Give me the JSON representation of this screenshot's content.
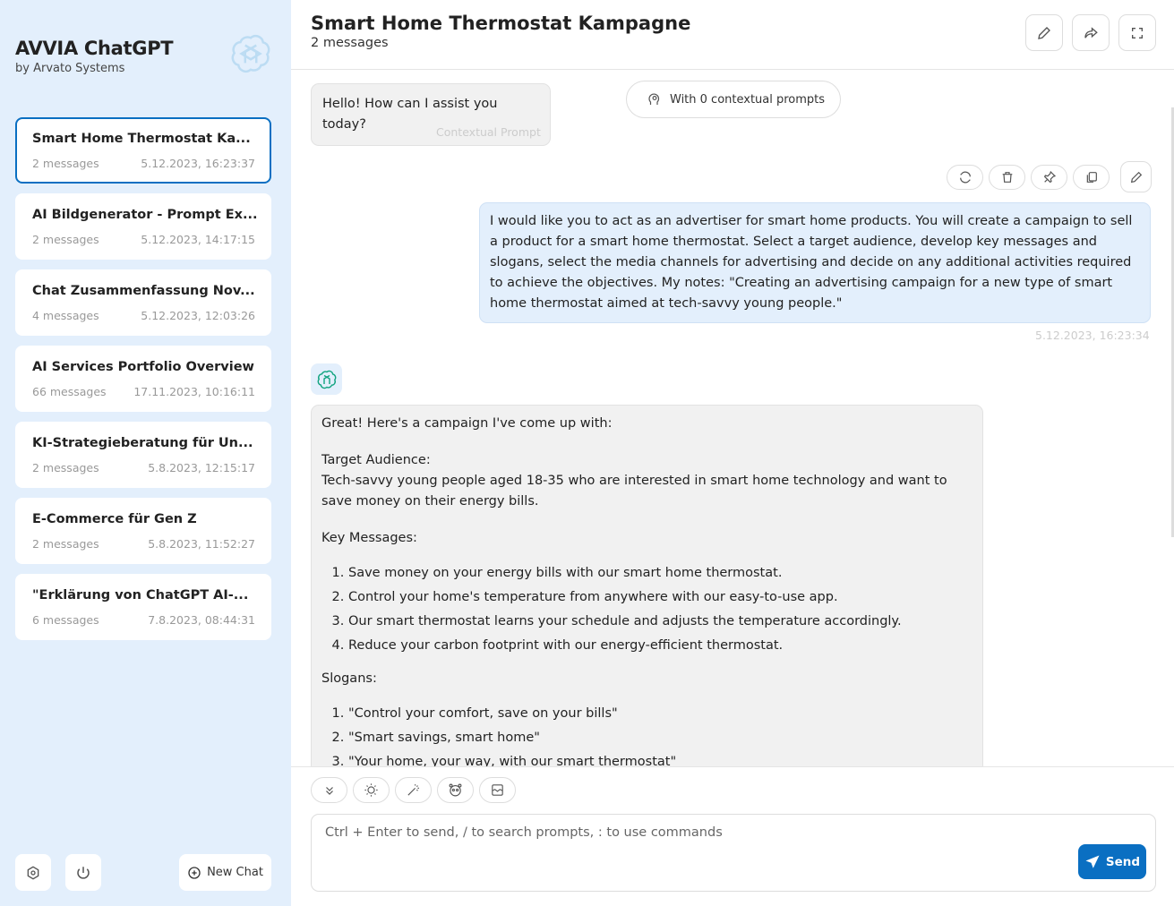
{
  "app": {
    "title": "AVVIA ChatGPT",
    "subtitle": "by Arvato Systems"
  },
  "conversations": [
    {
      "title": "Smart Home Thermostat Ka...",
      "count": "2 messages",
      "date": "5.12.2023, 16:23:37",
      "active": true
    },
    {
      "title": "AI Bildgenerator - Prompt Ex...",
      "count": "2 messages",
      "date": "5.12.2023, 14:17:15"
    },
    {
      "title": "Chat Zusammenfassung Nov...",
      "count": "4 messages",
      "date": "5.12.2023, 12:03:26"
    },
    {
      "title": "AI Services Portfolio Overview",
      "count": "66 messages",
      "date": "17.11.2023, 10:16:11"
    },
    {
      "title": "KI-Strategieberatung für Un...",
      "count": "2 messages",
      "date": "5.8.2023, 12:15:17"
    },
    {
      "title": "E-Commerce für Gen Z",
      "count": "2 messages",
      "date": "5.8.2023, 11:52:27"
    },
    {
      "title": "\"Erklärung von ChatGPT AI-...",
      "count": "6 messages",
      "date": "7.8.2023, 08:44:31"
    }
  ],
  "sidebar_footer": {
    "new_chat": "New Chat"
  },
  "header": {
    "title": "Smart Home Thermostat Kampagne",
    "subtitle": "2 messages"
  },
  "messages": {
    "greeting": "Hello! How can I assist you today?",
    "greeting_label": "Contextual Prompt",
    "context_pill": "With 0 contextual prompts",
    "user_text": "I would like you to act as an advertiser for smart home products. You will create a campaign to sell a product for a smart home thermostat. Select a target audience, develop key messages and slogans, select the media channels for advertising and decide on any additional activities required to achieve the objectives. My notes: \"Creating an advertising campaign for a new type of smart home thermostat aimed at tech-savvy young people.\"",
    "user_time": "5.12.2023, 16:23:34",
    "response": {
      "intro": "Great! Here's a campaign I've come up with:",
      "audience_heading": "Target Audience:",
      "audience_text": "Tech-savvy young people aged 18-35 who are interested in smart home technology and want to save money on their energy bills.",
      "key_heading": "Key Messages:",
      "key_messages": [
        "Save money on your energy bills with our smart home thermostat.",
        "Control your home's temperature from anywhere with our easy-to-use app.",
        "Our smart thermostat learns your schedule and adjusts the temperature accordingly.",
        "Reduce your carbon footprint with our energy-efficient thermostat."
      ],
      "slogans_heading": "Slogans:",
      "slogans": [
        "\"Control your comfort, save on your bills\"",
        "\"Smart savings, smart home\"",
        "\"Your home, your way, with our smart thermostat\""
      ]
    }
  },
  "composer": {
    "placeholder": "Ctrl + Enter to send, / to search prompts, : to use commands",
    "send": "Send"
  },
  "colors": {
    "accent": "#0a6fc2",
    "sidebar_bg": "#e3effc",
    "user_bubble": "#e3effc",
    "assistant_bubble": "#f1f1f1"
  }
}
